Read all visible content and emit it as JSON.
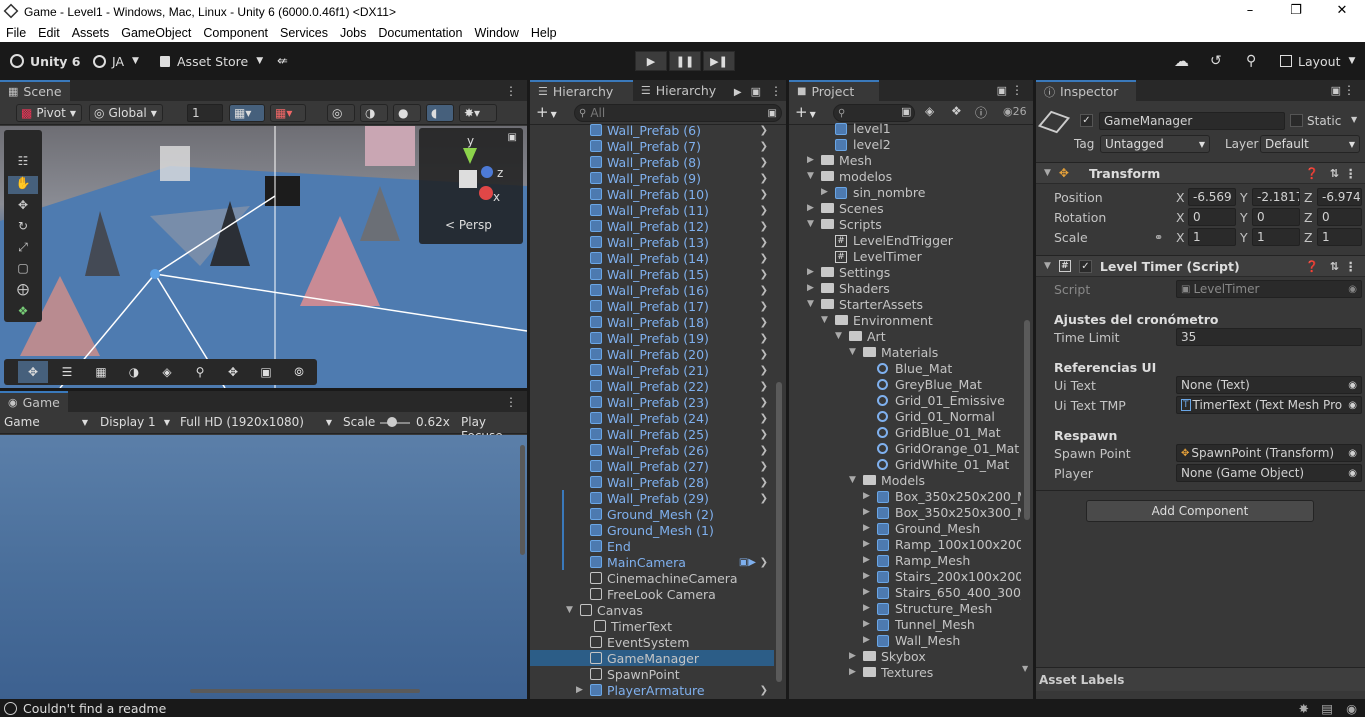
{
  "window": {
    "title": "Game - Level1 - Windows, Mac, Linux - Unity 6 (6000.0.46f1) <DX11>"
  },
  "menu": [
    "File",
    "Edit",
    "Assets",
    "GameObject",
    "Component",
    "Services",
    "Jobs",
    "Documentation",
    "Window",
    "Help"
  ],
  "toolbar": {
    "unity_label": "Unity 6",
    "account": "JA",
    "asset_store": "Asset Store",
    "layout": "Layout"
  },
  "scene": {
    "tab": "Scene",
    "pivot": "Pivot",
    "global": "Global",
    "grid_value": "1",
    "persp": "< Persp",
    "gizmo_y": "y",
    "gizmo_z": "z",
    "gizmo_x": "x"
  },
  "game": {
    "tab": "Game",
    "mode": "Game",
    "display": "Display 1",
    "resolution": "Full HD (1920x1080)",
    "scale_label": "Scale",
    "scale_value": "0.62x",
    "play_focus": "Play Focuse"
  },
  "hierarchy": {
    "tab1": "Hierarchy",
    "tab2": "Hierarchy",
    "search_placeholder": "All",
    "items": [
      {
        "label": "Wall_Prefab (6)",
        "prefab": true,
        "arrow": true
      },
      {
        "label": "Wall_Prefab (7)",
        "prefab": true,
        "arrow": true
      },
      {
        "label": "Wall_Prefab (8)",
        "prefab": true,
        "arrow": true
      },
      {
        "label": "Wall_Prefab (9)",
        "prefab": true,
        "arrow": true
      },
      {
        "label": "Wall_Prefab (10)",
        "prefab": true,
        "arrow": true
      },
      {
        "label": "Wall_Prefab (11)",
        "prefab": true,
        "arrow": true
      },
      {
        "label": "Wall_Prefab (12)",
        "prefab": true,
        "arrow": true
      },
      {
        "label": "Wall_Prefab (13)",
        "prefab": true,
        "arrow": true
      },
      {
        "label": "Wall_Prefab (14)",
        "prefab": true,
        "arrow": true
      },
      {
        "label": "Wall_Prefab (15)",
        "prefab": true,
        "arrow": true
      },
      {
        "label": "Wall_Prefab (16)",
        "prefab": true,
        "arrow": true
      },
      {
        "label": "Wall_Prefab (17)",
        "prefab": true,
        "arrow": true
      },
      {
        "label": "Wall_Prefab (18)",
        "prefab": true,
        "arrow": true
      },
      {
        "label": "Wall_Prefab (19)",
        "prefab": true,
        "arrow": true
      },
      {
        "label": "Wall_Prefab (20)",
        "prefab": true,
        "arrow": true
      },
      {
        "label": "Wall_Prefab (21)",
        "prefab": true,
        "arrow": true
      },
      {
        "label": "Wall_Prefab (22)",
        "prefab": true,
        "arrow": true
      },
      {
        "label": "Wall_Prefab (23)",
        "prefab": true,
        "arrow": true
      },
      {
        "label": "Wall_Prefab (24)",
        "prefab": true,
        "arrow": true
      },
      {
        "label": "Wall_Prefab (25)",
        "prefab": true,
        "arrow": true
      },
      {
        "label": "Wall_Prefab (26)",
        "prefab": true,
        "arrow": true
      },
      {
        "label": "Wall_Prefab (27)",
        "prefab": true,
        "arrow": true
      },
      {
        "label": "Wall_Prefab (28)",
        "prefab": true,
        "arrow": true
      },
      {
        "label": "Wall_Prefab (29)",
        "prefab": true,
        "arrow": true
      },
      {
        "label": "Ground_Mesh (2)",
        "prefab": true,
        "arrow": false
      },
      {
        "label": "Ground_Mesh (1)",
        "prefab": true,
        "arrow": false
      },
      {
        "label": "End",
        "prefab": true,
        "arrow": false
      },
      {
        "label": "MainCamera",
        "prefab": true,
        "arrow": true
      },
      {
        "label": "CinemachineCamera",
        "prefab": false,
        "arrow": false
      },
      {
        "label": "FreeLook Camera",
        "prefab": false,
        "arrow": false
      },
      {
        "label": "Canvas",
        "prefab": false,
        "arrow": false
      },
      {
        "label": "TimerText",
        "prefab": false,
        "arrow": false
      },
      {
        "label": "EventSystem",
        "prefab": false,
        "arrow": false
      },
      {
        "label": "GameManager",
        "prefab": false,
        "arrow": false
      },
      {
        "label": "SpawnPoint",
        "prefab": false,
        "arrow": false
      },
      {
        "label": "PlayerArmature",
        "prefab": true,
        "arrow": true
      }
    ]
  },
  "project": {
    "tab": "Project",
    "hidden_count": "26",
    "items": [
      {
        "label": "level1",
        "kind": "scene",
        "indent": 2
      },
      {
        "label": "level2",
        "kind": "scene",
        "indent": 2
      },
      {
        "label": "Mesh",
        "kind": "folder",
        "indent": 1
      },
      {
        "label": "modelos",
        "kind": "folder",
        "indent": 1
      },
      {
        "label": "sin_nombre",
        "kind": "model",
        "indent": 2
      },
      {
        "label": "Scenes",
        "kind": "folder",
        "indent": 1
      },
      {
        "label": "Scripts",
        "kind": "folder",
        "indent": 1
      },
      {
        "label": "LevelEndTrigger",
        "kind": "script",
        "indent": 2
      },
      {
        "label": "LevelTimer",
        "kind": "script",
        "indent": 2
      },
      {
        "label": "Settings",
        "kind": "folder",
        "indent": 1
      },
      {
        "label": "Shaders",
        "kind": "folder",
        "indent": 1
      },
      {
        "label": "StarterAssets",
        "kind": "folder",
        "indent": 1
      },
      {
        "label": "Environment",
        "kind": "folder",
        "indent": 2
      },
      {
        "label": "Art",
        "kind": "folder",
        "indent": 3
      },
      {
        "label": "Materials",
        "kind": "folder",
        "indent": 4
      },
      {
        "label": "Blue_Mat",
        "kind": "mat",
        "indent": 5
      },
      {
        "label": "GreyBlue_Mat",
        "kind": "mat",
        "indent": 5
      },
      {
        "label": "Grid_01_Emissive",
        "kind": "mat",
        "indent": 5
      },
      {
        "label": "Grid_01_Normal",
        "kind": "mat",
        "indent": 5
      },
      {
        "label": "GridBlue_01_Mat",
        "kind": "mat",
        "indent": 5
      },
      {
        "label": "GridOrange_01_Mat",
        "kind": "mat",
        "indent": 5
      },
      {
        "label": "GridWhite_01_Mat",
        "kind": "mat",
        "indent": 5
      },
      {
        "label": "Models",
        "kind": "folder",
        "indent": 4
      },
      {
        "label": "Box_350x250x200_Me",
        "kind": "model",
        "indent": 5
      },
      {
        "label": "Box_350x250x300_Me",
        "kind": "model",
        "indent": 5
      },
      {
        "label": "Ground_Mesh",
        "kind": "model",
        "indent": 5
      },
      {
        "label": "Ramp_100x100x200_M",
        "kind": "model",
        "indent": 5
      },
      {
        "label": "Ramp_Mesh",
        "kind": "model",
        "indent": 5
      },
      {
        "label": "Stairs_200x100x200_N",
        "kind": "model",
        "indent": 5
      },
      {
        "label": "Stairs_650_400_300_M",
        "kind": "model",
        "indent": 5
      },
      {
        "label": "Structure_Mesh",
        "kind": "model",
        "indent": 5
      },
      {
        "label": "Tunnel_Mesh",
        "kind": "model",
        "indent": 5
      },
      {
        "label": "Wall_Mesh",
        "kind": "model",
        "indent": 5
      },
      {
        "label": "Skybox",
        "kind": "folder",
        "indent": 4
      },
      {
        "label": "Textures",
        "kind": "folder",
        "indent": 4
      }
    ]
  },
  "inspector": {
    "tab": "Inspector",
    "object_name": "GameManager",
    "static_label": "Static",
    "tag_label": "Tag",
    "tag_value": "Untagged",
    "layer_label": "Layer",
    "layer_value": "Default",
    "transform": {
      "title": "Transform",
      "position_label": "Position",
      "pos_x": "-6.569",
      "pos_y": "-2.1817",
      "pos_z": "-6.974",
      "rotation_label": "Rotation",
      "rot_x": "0",
      "rot_y": "0",
      "rot_z": "0",
      "scale_label": "Scale",
      "scale_x": "1",
      "scale_y": "1",
      "scale_z": "1",
      "x": "X",
      "y": "Y",
      "z": "Z"
    },
    "level_timer": {
      "title": "Level Timer (Script)",
      "script_label": "Script",
      "script_value": "LevelTimer",
      "section1": "Ajustes del cronómetro",
      "time_limit_label": "Time Limit",
      "time_limit_value": "35",
      "section2": "Referencias UI",
      "ui_text_label": "Ui Text",
      "ui_text_value": "None (Text)",
      "ui_text_tmp_label": "Ui Text TMP",
      "ui_text_tmp_value": "TimerText (Text Mesh Pro",
      "section3": "Respawn",
      "spawn_point_label": "Spawn Point",
      "spawn_point_value": "SpawnPoint (Transform)",
      "player_label": "Player",
      "player_value": "None (Game Object)"
    },
    "add_component": "Add Component",
    "asset_labels": "Asset Labels"
  },
  "status": {
    "message": "Couldn't find a readme"
  },
  "colors": {
    "accent": "#3a79bb",
    "prefab_text": "#7fb0ee",
    "selection": "#2c5d87",
    "panel": "#383838"
  }
}
